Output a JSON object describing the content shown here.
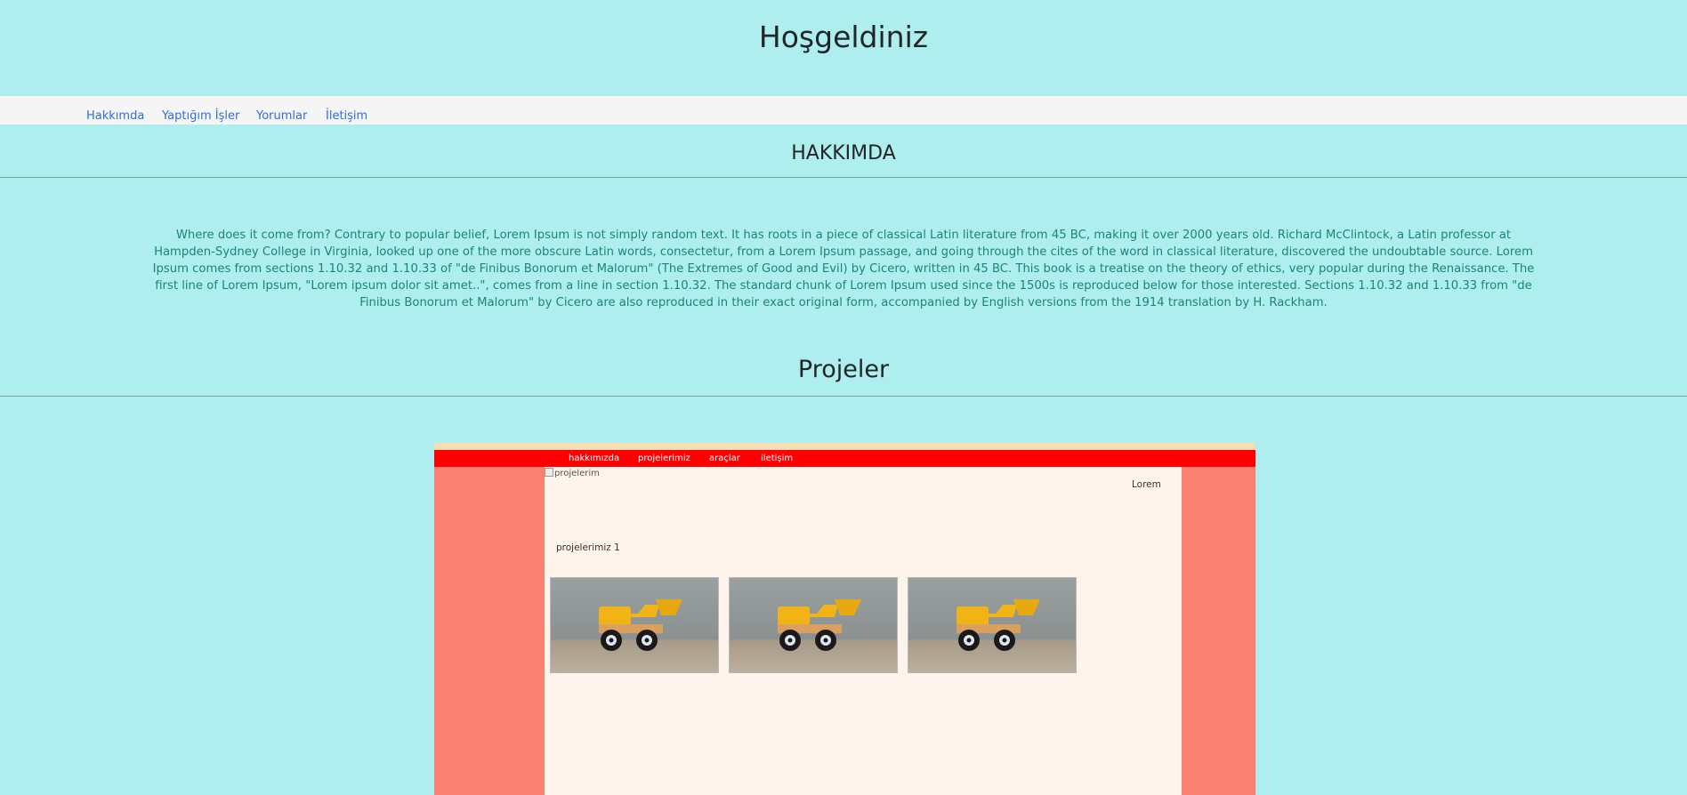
{
  "hero": {
    "title": "Hoşgeldiniz"
  },
  "nav": {
    "items": [
      "Hakkımda",
      "Yaptığım İşler",
      "Yorumlar",
      "İletişim"
    ]
  },
  "about": {
    "title": "HAKKIMDA",
    "text": "Where does it come from? Contrary to popular belief, Lorem Ipsum is not simply random text. It has roots in a piece of classical Latin literature from 45 BC, making it over 2000 years old. Richard McClintock, a Latin professor at Hampden-Sydney College in Virginia, looked up one of the more obscure Latin words, consectetur, from a Lorem Ipsum passage, and going through the cites of the word in classical literature, discovered the undoubtable source. Lorem Ipsum comes from sections 1.10.32 and 1.10.33 of \"de Finibus Bonorum et Malorum\" (The Extremes of Good and Evil) by Cicero, written in 45 BC. This book is a treatise on the theory of ethics, very popular during the Renaissance. The first line of Lorem Ipsum, \"Lorem ipsum dolor sit amet..\", comes from a line in section 1.10.32. The standard chunk of Lorem Ipsum used since the 1500s is reproduced below for those interested. Sections 1.10.32 and 1.10.33 from \"de Finibus Bonorum et Malorum\" by Cicero are also reproduced in their exact original form, accompanied by English versions from the 1914 translation by H. Rackham."
  },
  "projects": {
    "title": "Projeler",
    "preview": {
      "nav": [
        "hakkımızda",
        "projelerimiz",
        "araçlar",
        "iletişim"
      ],
      "image_alt": "projelerim",
      "side_text": "Lorem",
      "section_heading": "projelerimiz 1",
      "thumbnails": [
        "toy-bulldozer-image",
        "toy-bulldozer-image",
        "toy-bulldozer-image"
      ]
    }
  },
  "colors": {
    "page_bg": "#afeeee",
    "nav_bg": "#f5f5f5",
    "link": "#2f6fd6",
    "about_text": "#1c8577",
    "preview_nav": "#ff0000",
    "preview_side": "#fa8072",
    "preview_content": "#fff4ec"
  }
}
